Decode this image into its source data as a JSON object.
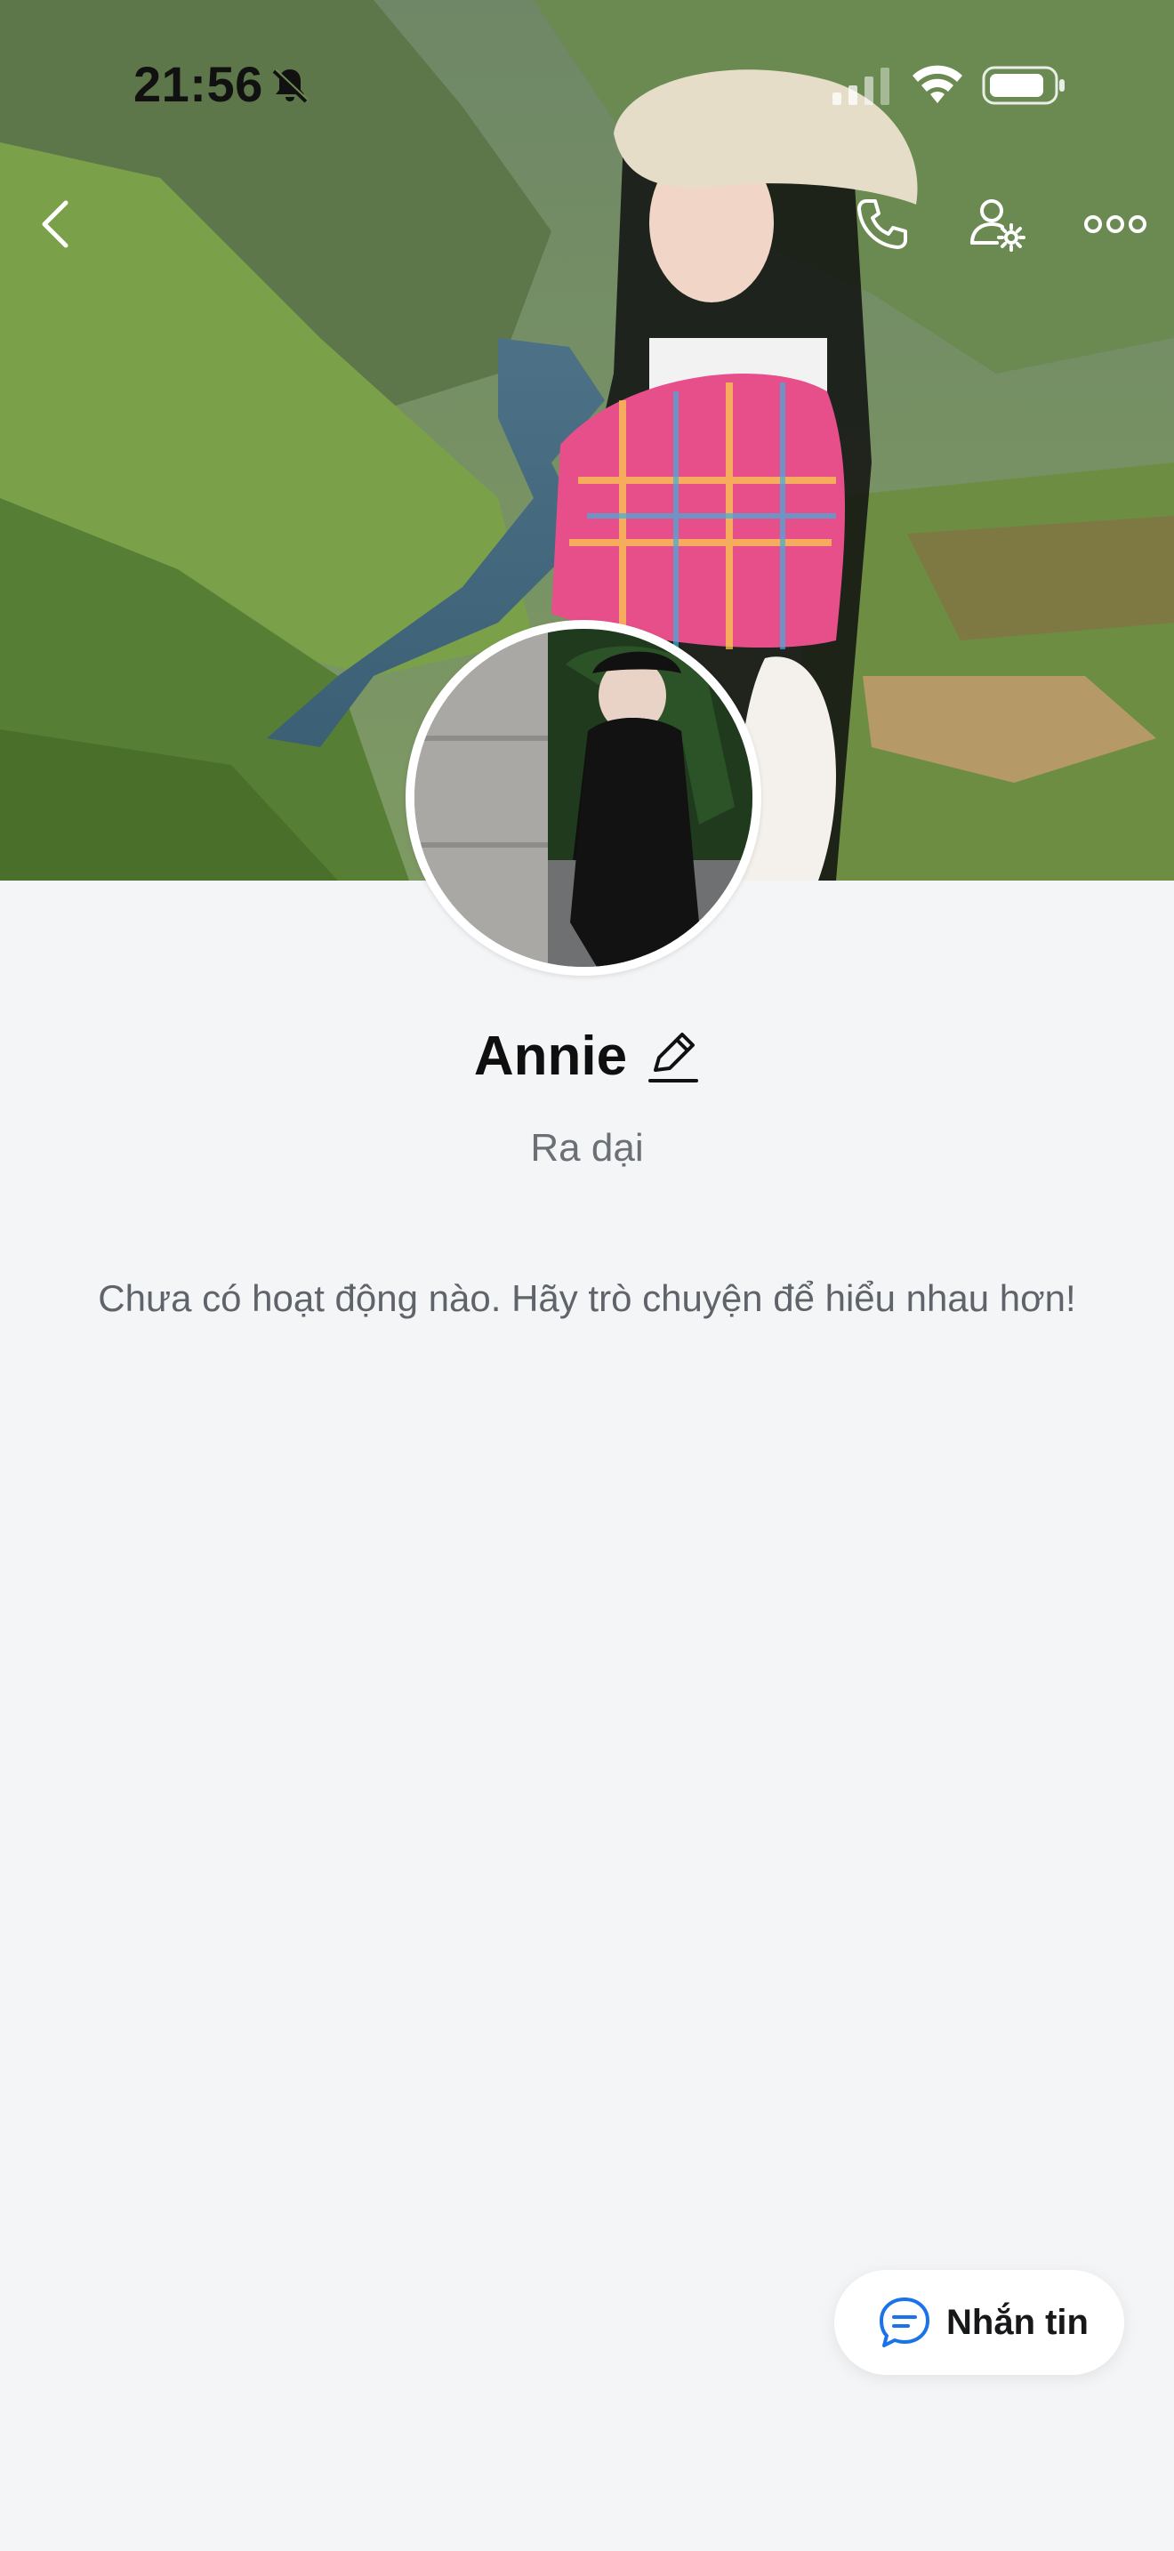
{
  "status_bar": {
    "time": "21:56",
    "icons": [
      "bell-off-icon",
      "signal-icon",
      "wifi-icon",
      "battery-icon"
    ]
  },
  "nav": {
    "back_icon": "chevron-left-icon",
    "call_icon": "phone-icon",
    "settings_icon": "user-settings-icon",
    "more_icon": "more-dots-icon"
  },
  "profile": {
    "name": "Annie",
    "edit_icon": "pencil-icon",
    "status": "Ra dại",
    "empty_activity": "Chưa có hoạt động nào. Hãy trò chuyện để hiểu nhau hơn!"
  },
  "message_button": {
    "icon": "chat-bubble-icon",
    "label": "Nhắn tin"
  },
  "colors": {
    "background": "#f4f5f7",
    "accent": "#1a73e8",
    "text_primary": "#0f0f10",
    "text_secondary": "#6b6f76"
  }
}
